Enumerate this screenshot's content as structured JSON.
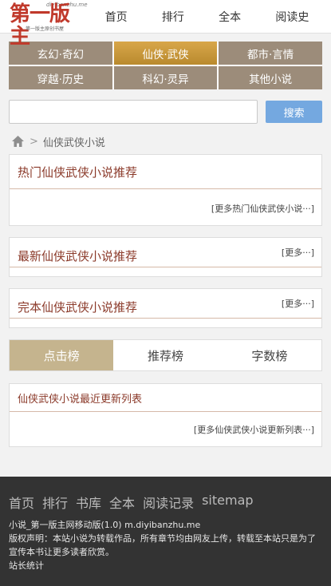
{
  "logo": {
    "main": "第一版主",
    "domain": "diyibanzhu.me",
    "tagline": "第一版主原创书屋"
  },
  "topnav": [
    {
      "label": "首页"
    },
    {
      "label": "排行"
    },
    {
      "label": "全本"
    },
    {
      "label": "阅读史"
    }
  ],
  "categories": [
    {
      "label": "玄幻·奇幻",
      "active": false
    },
    {
      "label": "仙侠·武侠",
      "active": true
    },
    {
      "label": "都市·言情",
      "active": false
    },
    {
      "label": "穿越·历史",
      "active": false
    },
    {
      "label": "科幻·灵异",
      "active": false
    },
    {
      "label": "其他小说",
      "active": false
    }
  ],
  "search": {
    "placeholder": "",
    "value": "",
    "button": "搜索"
  },
  "breadcrumb": {
    "current": "仙侠武侠小说",
    "separator": ">"
  },
  "sections": {
    "hot": {
      "title": "热门仙侠武侠小说推荐",
      "more": "[更多热门仙侠武侠小说···]"
    },
    "new": {
      "title": "最新仙侠武侠小说推荐",
      "more": "[更多···]"
    },
    "complete": {
      "title": "完本仙侠武侠小说推荐",
      "more": "[更多···]"
    },
    "recent": {
      "title": "仙侠武侠小说最近更新列表",
      "more": "[更多仙侠武侠小说更新列表···]"
    }
  },
  "tabs": [
    {
      "label": "点击榜",
      "active": true
    },
    {
      "label": "推荐榜",
      "active": false
    },
    {
      "label": "字数榜",
      "active": false
    }
  ],
  "footer": {
    "links": [
      "首页",
      "排行",
      "书库",
      "全本",
      "阅读记录",
      "sitemap"
    ],
    "line1": "小说_第一版主网移动版(1.0) m.diyibanzhu.me",
    "line2": "版权声明：本站小说为转载作品，所有章节均由网友上传，转载至本站只是为了宣传本书让更多读者欣赏。",
    "line3": "站长统计"
  },
  "colors": {
    "category_bg": "#9c8c7a",
    "category_active": "#c9983a",
    "search_button": "#74a8e0",
    "tab_active": "#c5b48e",
    "title_text": "#8b3a2a",
    "footer_bg": "#333333"
  }
}
